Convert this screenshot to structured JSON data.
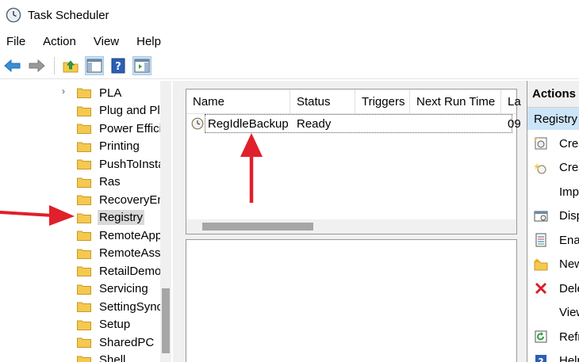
{
  "window": {
    "title": "Task Scheduler"
  },
  "menu": [
    "File",
    "Action",
    "View",
    "Help"
  ],
  "toolbar": {
    "icons": [
      "back-arrow-icon",
      "forward-arrow-icon",
      "up-folder-icon",
      "show-hide-console-tree-icon",
      "help-icon",
      "show-hide-action-pane-icon"
    ]
  },
  "tree": {
    "items": [
      {
        "label": "PLA",
        "selected": false
      },
      {
        "label": "Plug and Pla",
        "selected": false
      },
      {
        "label": "Power Efficie",
        "selected": false
      },
      {
        "label": "Printing",
        "selected": false
      },
      {
        "label": "PushToInsta",
        "selected": false
      },
      {
        "label": "Ras",
        "selected": false
      },
      {
        "label": "RecoveryEn",
        "selected": false
      },
      {
        "label": "Registry",
        "selected": true
      },
      {
        "label": "RemoteApp",
        "selected": false
      },
      {
        "label": "RemoteAssi",
        "selected": false
      },
      {
        "label": "RetailDemo",
        "selected": false
      },
      {
        "label": "Servicing",
        "selected": false
      },
      {
        "label": "SettingSync",
        "selected": false
      },
      {
        "label": "Setup",
        "selected": false
      },
      {
        "label": "SharedPC",
        "selected": false
      },
      {
        "label": "Shell",
        "selected": false
      }
    ],
    "chevron": "›"
  },
  "task_list": {
    "columns": [
      "Name",
      "Status",
      "Triggers",
      "Next Run Time",
      "La"
    ],
    "rows": [
      {
        "name": "RegIdleBackup",
        "status": "Ready",
        "triggers": "",
        "next_run": "",
        "last": "09"
      }
    ]
  },
  "actions": {
    "header": "Actions",
    "section": "Registry",
    "items": [
      {
        "label": "Crea",
        "icon": "create-basic-task-icon"
      },
      {
        "label": "Crea",
        "icon": "create-task-icon"
      },
      {
        "label": "Imp",
        "icon": "none"
      },
      {
        "label": "Disp",
        "icon": "display-running-tasks-icon"
      },
      {
        "label": "Enal",
        "icon": "enable-history-icon"
      },
      {
        "label": "New",
        "icon": "new-folder-icon"
      },
      {
        "label": "Dele",
        "icon": "delete-icon"
      },
      {
        "label": "View",
        "icon": "none"
      },
      {
        "label": "Refr",
        "icon": "refresh-icon"
      },
      {
        "label": "Help",
        "icon": "help-icon"
      }
    ]
  },
  "colors": {
    "annotation_arrow": "#e0202a",
    "selection_highlight": "#cce4f7",
    "folder_yellow": "#f5c94f"
  }
}
